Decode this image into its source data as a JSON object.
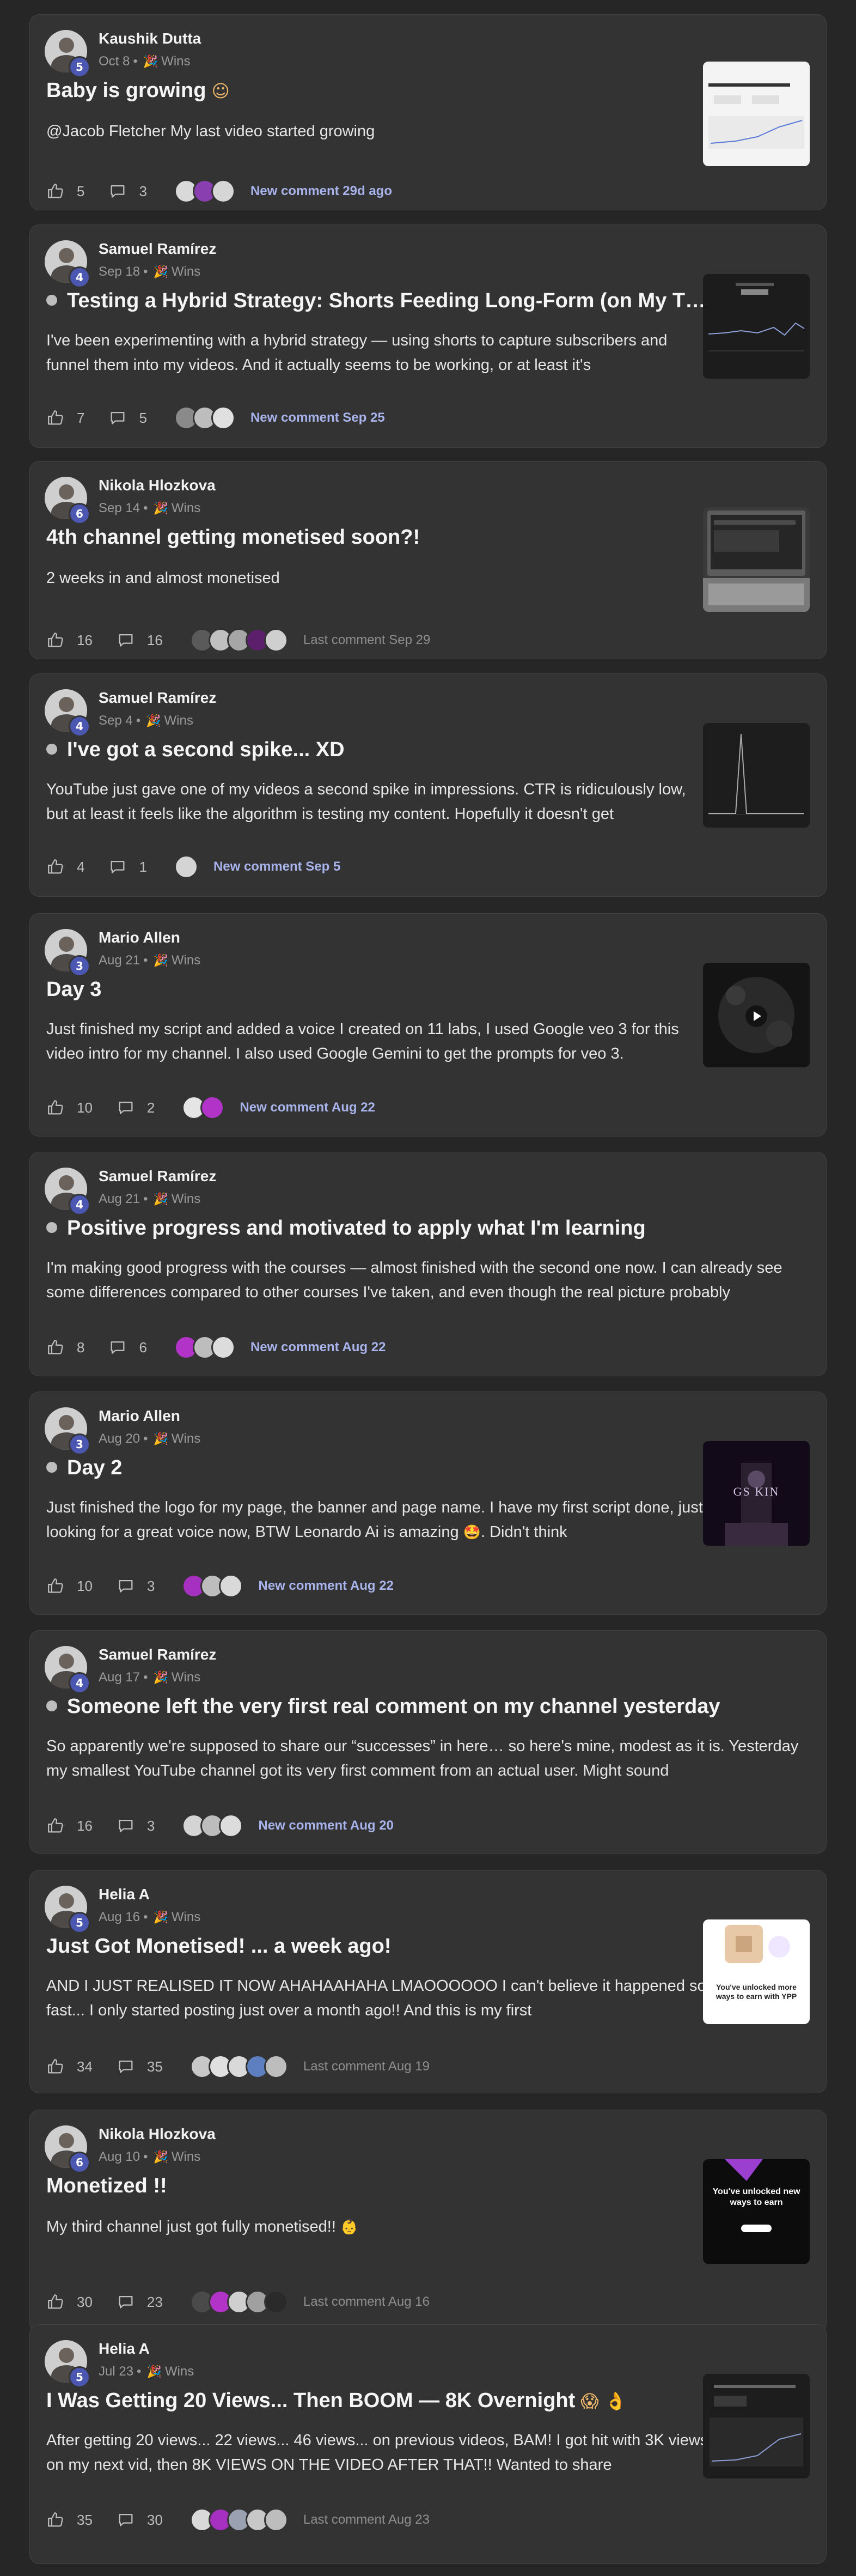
{
  "colors": {
    "page_bg": "#262626",
    "card_bg": "#333333",
    "accent_link": "#a7b3ea",
    "level_badge": "#4b57b0"
  },
  "icons": {
    "like": "thumbs-up-icon",
    "comment": "speech-bubble-icon",
    "category": "party-popper-icon"
  },
  "posts": [
    {
      "author": "Kaushik Dutta",
      "level": "5",
      "date": "Oct 8",
      "separator": "•",
      "category": "Wins",
      "title": "Baby is growing",
      "title_emoji": "☺",
      "body": "@Jacob Fletcher My last video started growing",
      "likes": "5",
      "comments": "3",
      "activity": "New comment 29d ago",
      "thumbnail": "light-screenshot"
    },
    {
      "author": "Samuel Ramírez",
      "level": "4",
      "date": "Sep 18",
      "separator": "•",
      "category": "Wins",
      "title": "Testing a Hybrid Strategy: Shorts Feeding Long-Form (on My Thr...",
      "title_emoji": "",
      "body": "I've been experimenting with a hybrid strategy — using shorts to capture subscribers and funnel them into my videos. And it actually seems to be working, or at least it's",
      "likes": "7",
      "comments": "5",
      "activity": "New comment Sep 25",
      "thumbnail": "dark-analytics"
    },
    {
      "author": "Nikola Hlozkova",
      "level": "6",
      "date": "Sep 14",
      "separator": "•",
      "category": "Wins",
      "title": "4th channel getting monetised soon?!",
      "title_emoji": "",
      "body": "2 weeks in and almost monetised",
      "likes": "16",
      "comments": "16",
      "activity": "Last comment Sep 29",
      "thumbnail": "laptop-photo"
    },
    {
      "author": "Samuel Ramírez",
      "level": "4",
      "date": "Sep 4",
      "separator": "•",
      "category": "Wins",
      "title": "I've got a second spike... XD",
      "title_emoji": "",
      "body": "YouTube just gave one of my videos a second spike in impressions. CTR is ridiculously low, but at least it feels like the algorithm is testing my content. Hopefully it doesn't get",
      "likes": "4",
      "comments": "1",
      "activity": "New comment Sep 5",
      "thumbnail": "spike-chart"
    },
    {
      "author": "Mario Allen",
      "level": "3",
      "date": "Aug 21",
      "separator": "•",
      "category": "Wins",
      "title": "Day 3",
      "title_emoji": "",
      "body": "Just finished my script and added a voice I created on 11 labs, I used Google veo 3 for this video intro for my channel. I also used Google Gemini to get the prompts for veo 3.",
      "likes": "10",
      "comments": "2",
      "activity": "New comment Aug 22",
      "thumbnail": "video-dark"
    },
    {
      "author": "Samuel Ramírez",
      "level": "4",
      "date": "Aug 21",
      "separator": "•",
      "category": "Wins",
      "title": "Positive progress and motivated to apply what I'm learning",
      "title_emoji": "",
      "body": "I'm making good progress with the courses — almost finished with the second one now. I can already see some differences compared to other courses I've taken, and even though the real picture probably",
      "likes": "8",
      "comments": "6",
      "activity": "New comment Aug 22",
      "thumbnail": ""
    },
    {
      "author": "Mario Allen",
      "level": "3",
      "date": "Aug 20",
      "separator": "•",
      "category": "Wins",
      "title": "Day 2",
      "title_emoji": "",
      "body": "Just finished the logo for my page, the banner and page name. I have my first script done, just looking for a great voice now, BTW Leonardo Ai is amazing",
      "body_emoji": "🤩",
      "body_tail": ". Didn't think",
      "likes": "10",
      "comments": "3",
      "activity": "New comment Aug 22",
      "thumbnail": "throne-art",
      "thumbnail_text": "GS   KIN"
    },
    {
      "author": "Samuel Ramírez",
      "level": "4",
      "date": "Aug 17",
      "separator": "•",
      "category": "Wins",
      "title": "Someone left the very first real comment on my channel yesterday",
      "title_emoji": "",
      "body": "So apparently we're supposed to share our “successes” in here… so here's mine, modest as it is. Yesterday my smallest YouTube channel got its very first comment from an actual user. Might sound",
      "likes": "16",
      "comments": "3",
      "activity": "New comment Aug 20",
      "thumbnail": ""
    },
    {
      "author": "Helia A",
      "level": "5",
      "date": "Aug 16",
      "separator": "•",
      "category": "Wins",
      "title": "Just Got Monetised! ... a week ago!",
      "title_emoji": "",
      "body": "AND I JUST REALISED IT NOW AHAHAAHAHA LMAOOOOOO I can't believe it happened so fast... I only started posting just over a month ago!! And this is my first",
      "likes": "34",
      "comments": "35",
      "activity": "Last comment Aug 19",
      "thumbnail": "unlocked-ways",
      "thumbnail_text": "You've unlocked more ways to earn with YPP"
    },
    {
      "author": "Nikola Hlozkova",
      "level": "6",
      "date": "Aug 10",
      "separator": "•",
      "category": "Wins",
      "title": "Monetized !!",
      "title_emoji": "",
      "body": "My third channel just got fully monetised!!",
      "body_emoji": "👶",
      "likes": "30",
      "comments": "23",
      "activity": "Last comment Aug 16",
      "thumbnail": "ways-to-earn",
      "thumbnail_text": "You've unlocked new ways to earn"
    },
    {
      "author": "Helia A",
      "level": "5",
      "date": "Jul 23",
      "separator": "•",
      "category": "Wins",
      "title": "I Was Getting 20 Views... Then BOOM — 8K Overnight",
      "title_emoji": "😱 👌",
      "body": "After getting 20 views... 22 views... 46 views... on previous videos, BAM! I got hit with 3K views on my next vid, then 8K VIEWS ON THE VIDEO AFTER THAT!! Wanted to share",
      "likes": "35",
      "comments": "30",
      "activity": "Last comment Aug 23",
      "thumbnail": "dark-views"
    }
  ]
}
